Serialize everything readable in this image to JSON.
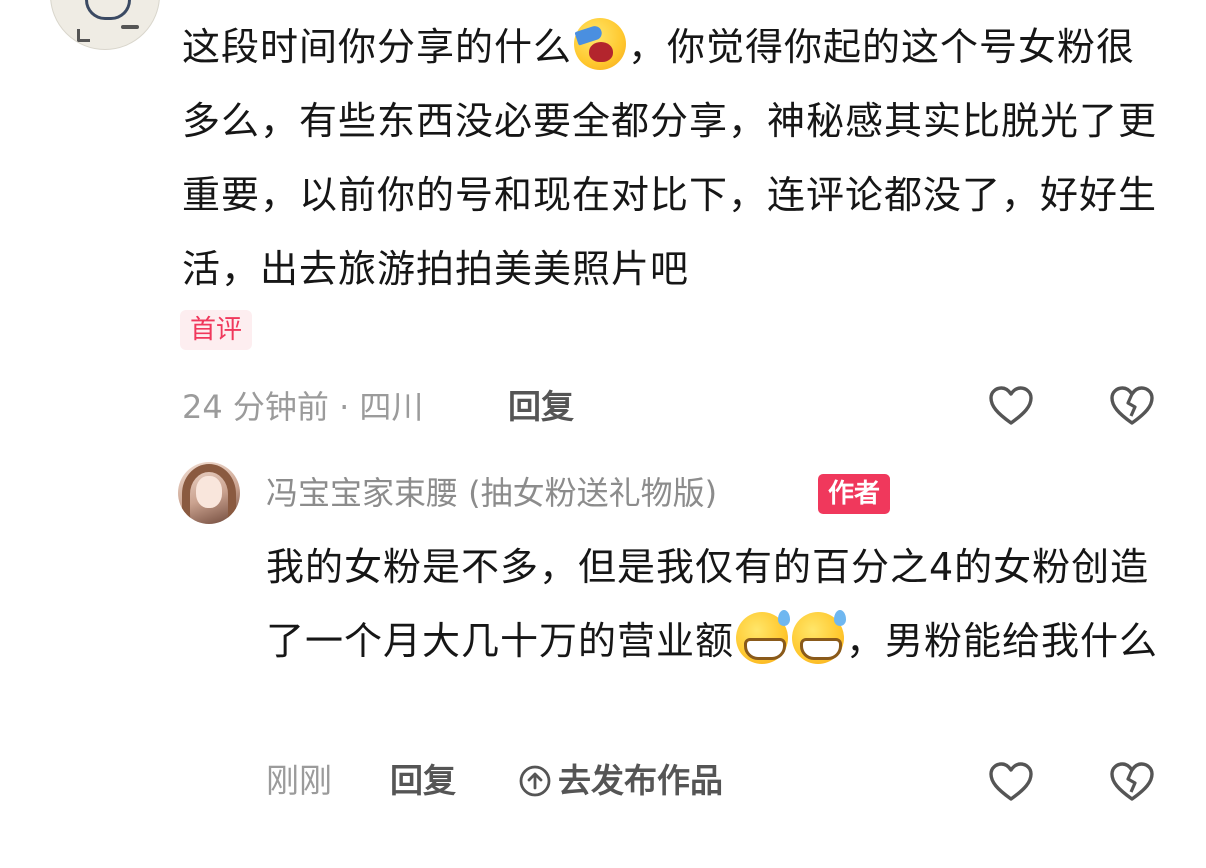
{
  "comment": {
    "text_part1": "这段时间你分享的什么",
    "emoji_1": "yawning-face-emoji",
    "text_part2": "，你觉得你起的这个号女粉很多么，有些东西没必要全都分享，神秘感其实比脱光了更重要，以前你的号和现在对比下，连评论都没了，好好生活，出去旅游拍拍美美照片吧",
    "badge": "首评",
    "time_location": "24 分钟前 · 四川",
    "reply_label": "回复"
  },
  "reply": {
    "author": "冯宝宝家束腰 (抽女粉送礼物版)",
    "author_tag": "作者",
    "text_part1": "我的女粉是不多，但是我仅有的百分之4的女粉创造了一个月大几十万的营业额",
    "emoji": "grinning-sweat-emoji",
    "text_part2": "，男粉能给我什么",
    "time": "刚刚",
    "reply_label": "回复",
    "publish_label": "去发布作品"
  },
  "colors": {
    "accent": "#f0385c",
    "badge_bg": "#fdeef0",
    "meta_gray": "#9b9b9b",
    "text": "#161616"
  }
}
